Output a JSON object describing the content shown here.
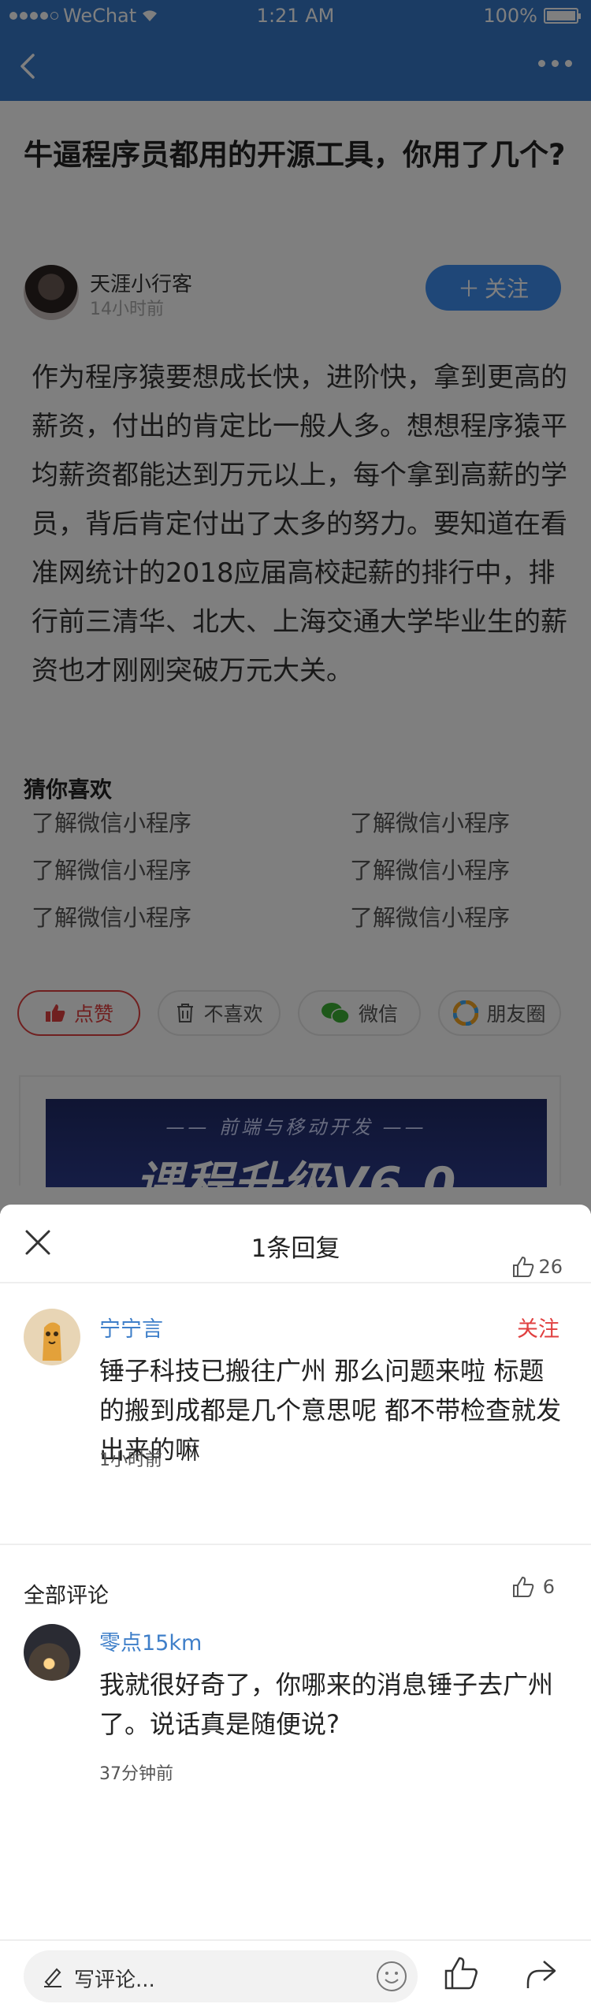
{
  "status_bar": {
    "carrier": "WeChat",
    "time": "1:21 AM",
    "battery": "100%"
  },
  "article": {
    "title": "牛逼程序员都用的开源工具，你用了几个?",
    "author": {
      "name": "天涯小行客",
      "time": "14小时前"
    },
    "follow_label": "关注",
    "body": "作为程序猿要想成长快，进阶快，拿到更高的薪资，付出的肯定比一般人多。想想程序猿平均薪资都能达到万元以上，每个拿到高薪的学员，背后肯定付出了太多的努力。要知道在看准网统计的2018应届高校起薪的排行中，排行前三清华、北大、上海交通大学毕业生的薪资也才刚刚突破万元大关。",
    "guess": {
      "title": "猜你喜欢",
      "items": [
        "了解微信小程序",
        "了解微信小程序",
        "了解微信小程序",
        "了解微信小程序",
        "了解微信小程序",
        "了解微信小程序"
      ]
    },
    "actions": {
      "like": "点赞",
      "dislike": "不喜欢",
      "wechat": "微信",
      "moments": "朋友圈"
    },
    "banner": {
      "subtitle": "—— 前端与移动开发 ——",
      "main": "课程升级V6.0"
    }
  },
  "sheet": {
    "title": "1条回复",
    "likes": "26",
    "reply": {
      "name": "宁宁言",
      "follow": "关注",
      "text": "锤子科技已搬往广州 那么问题来啦 标题的搬到成都是几个意思呢 都不带检查就发出来的嘛",
      "time": "1小时前"
    },
    "all_comments": {
      "title": "全部评论",
      "likes": "6",
      "items": [
        {
          "name": "零点15km",
          "text": "我就很好奇了，你哪来的消息锤子去广州了。说话真是随便说?",
          "time": "37分钟前"
        }
      ]
    }
  },
  "bottom_bar": {
    "placeholder": "写评论..."
  },
  "colors": {
    "nav": "#3679c9",
    "follow_btn": "#3f8ef0",
    "accent_red": "#e04040",
    "link_blue": "#3f7fc9"
  }
}
